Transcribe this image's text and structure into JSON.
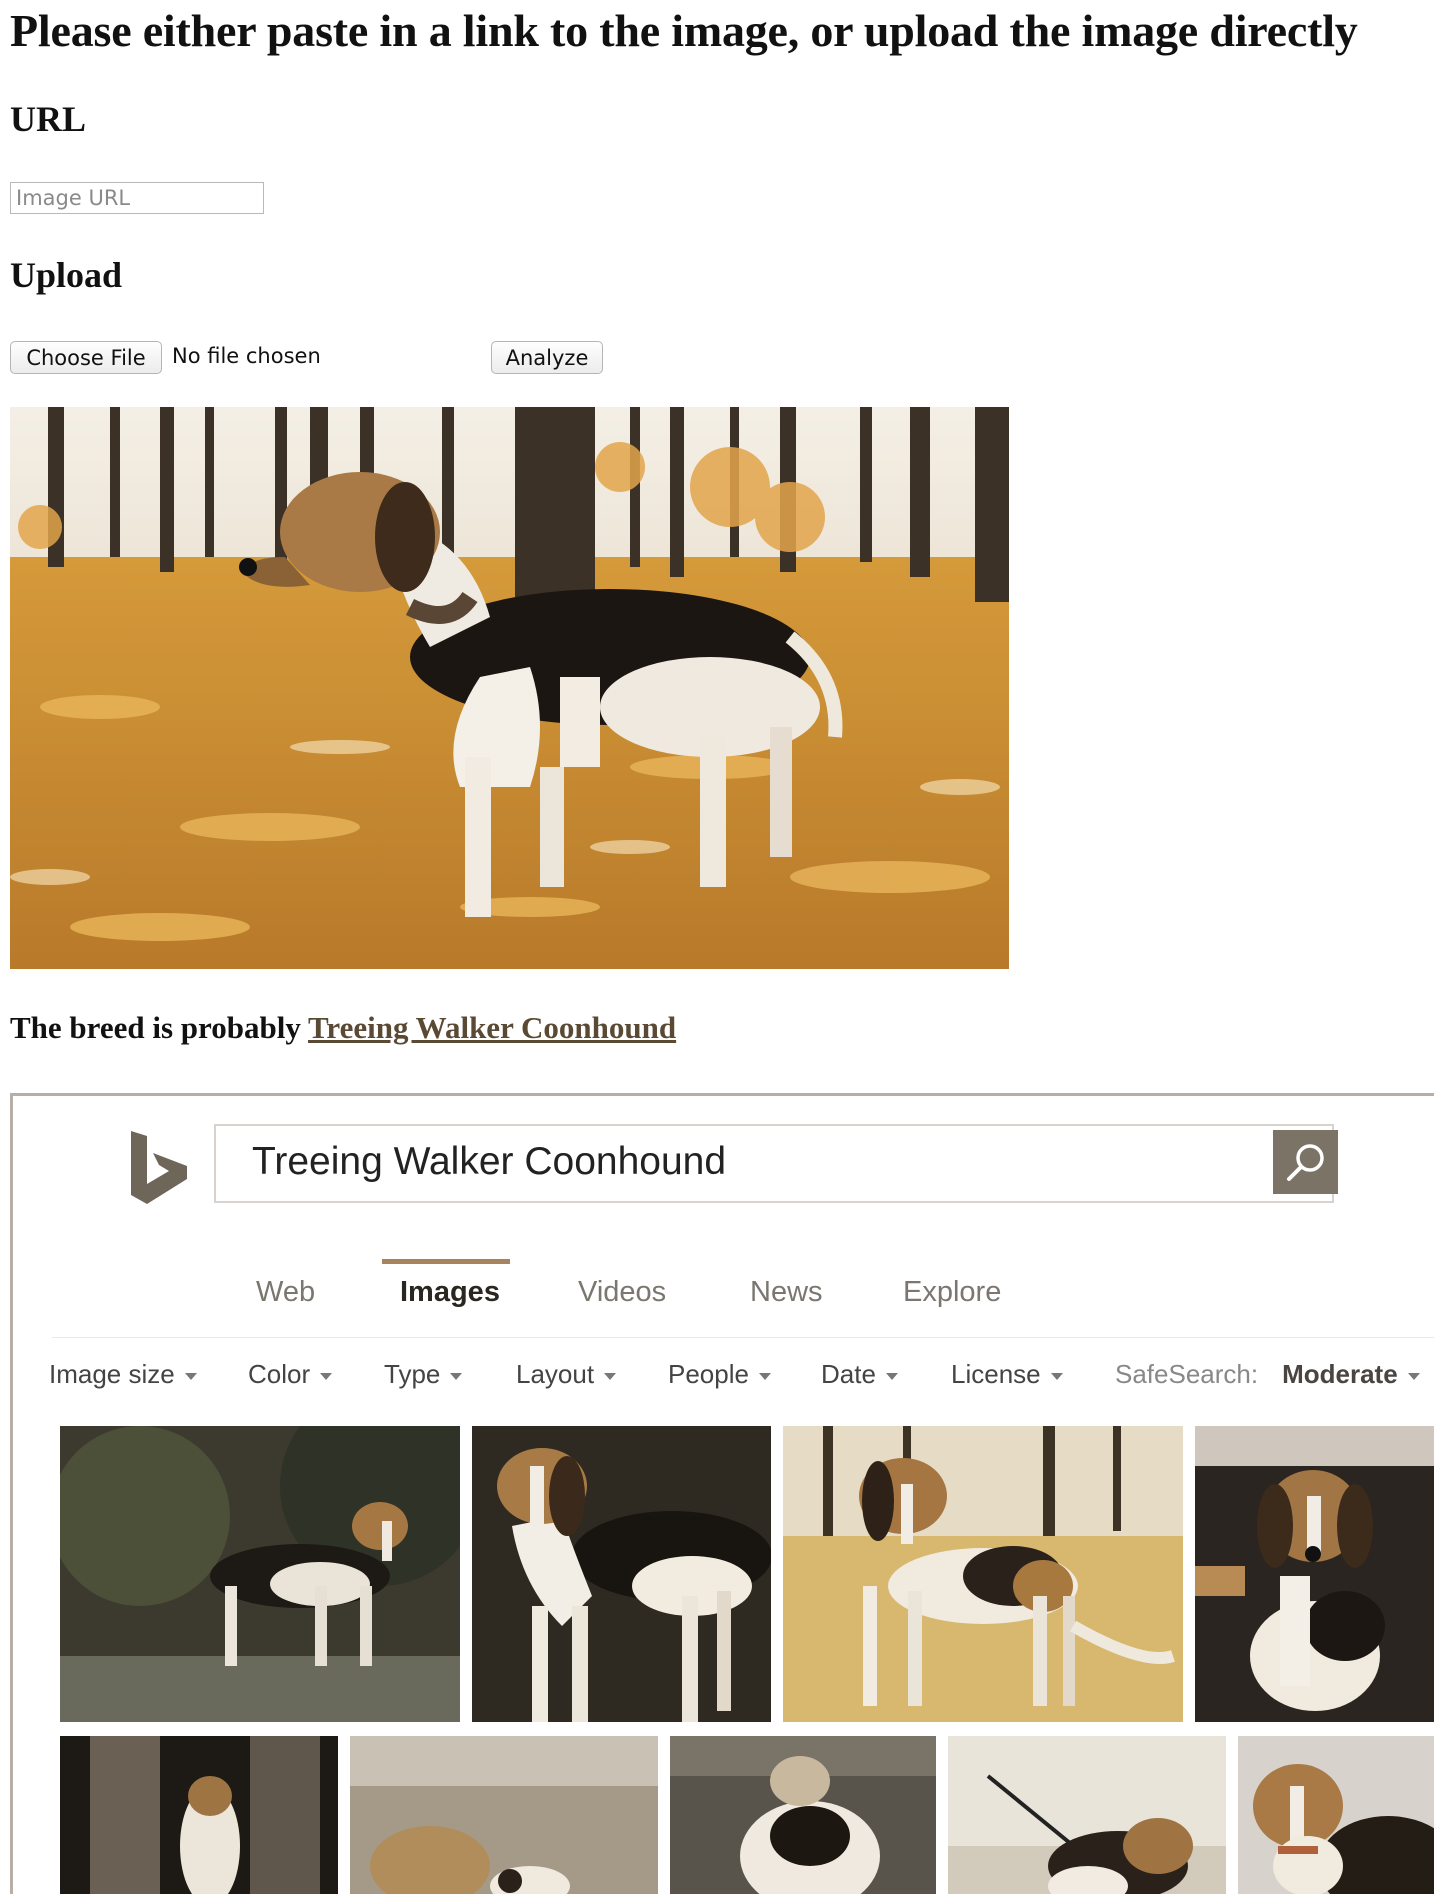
{
  "page": {
    "title": "Please either paste in a link to the image, or upload the image directly",
    "url_heading": "URL",
    "url_input": {
      "placeholder": "Image URL",
      "value": ""
    },
    "upload_heading": "Upload",
    "choose_file_label": "Choose File",
    "file_status": "No file chosen",
    "analyze_label": "Analyze",
    "result_prefix": "The breed is probably ",
    "result_breed": "Treeing Walker Coonhound"
  },
  "bing": {
    "search_query": "Treeing Walker Coonhound",
    "nav": [
      {
        "label": "Web"
      },
      {
        "label": "Images",
        "active": true
      },
      {
        "label": "Videos"
      },
      {
        "label": "News"
      },
      {
        "label": "Explore"
      }
    ],
    "filters": [
      "Image size",
      "Color",
      "Type",
      "Layout",
      "People",
      "Date",
      "License"
    ],
    "safesearch_label": "SafeSearch:",
    "safesearch_value": "Moderate"
  },
  "colors": {
    "accent": "#a9835d",
    "search_button": "#7c7367",
    "link": "#5a4a34"
  }
}
